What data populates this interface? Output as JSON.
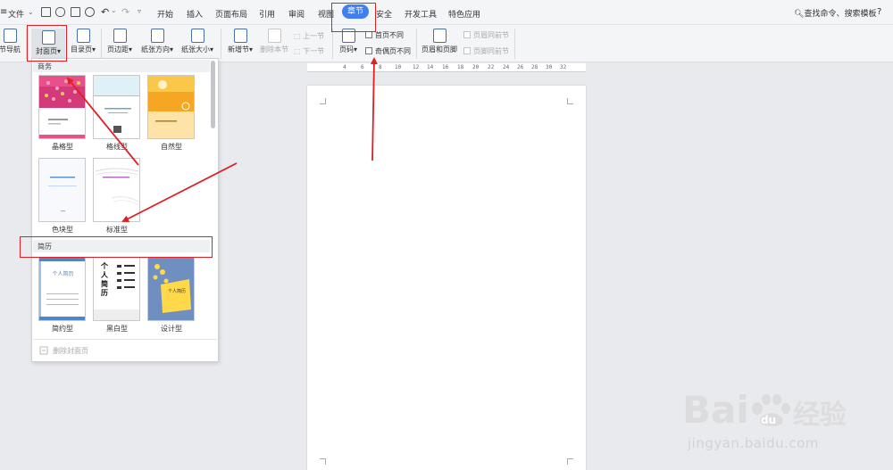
{
  "menubar": {
    "file": "文件",
    "tabs": [
      "开始",
      "插入",
      "页面布局",
      "引用",
      "审阅",
      "视图",
      "章节",
      "安全",
      "开发工具",
      "特色应用"
    ],
    "active_tab": "章节",
    "search": "查找命令、搜索模板",
    "help": "?"
  },
  "ribbon": {
    "section_nav": "节导航",
    "cover_page": "封面页",
    "toc_page": "目录页",
    "margins": "页边距",
    "orientation": "纸张方向",
    "paper_size": "纸张大小",
    "new_section": "新增节",
    "delete_section": "删除本节",
    "prev_section": "上一节",
    "next_section": "下一节",
    "page_number": "页码",
    "first_page_diff": "首页不同",
    "odd_even_diff": "奇偶页不同",
    "header_footer": "页眉和页脚",
    "header_same_prev": "页眉同前节",
    "footer_same_prev": "页脚同前节"
  },
  "ruler": {
    "ticks": [
      "4",
      "6",
      "8",
      "10",
      "12",
      "14",
      "16",
      "18",
      "20",
      "22",
      "24",
      "26",
      "28",
      "30",
      "32",
      "34",
      "36",
      "38"
    ]
  },
  "gallery": {
    "section_business": "商务",
    "section_resume": "简历",
    "business_items": [
      "晶格型",
      "格线型",
      "自然型",
      "色块型",
      "标准型"
    ],
    "resume_items": [
      "简约型",
      "黑白型",
      "设计型"
    ],
    "resume_thumb_title": "个人简历",
    "resume_vertical": [
      "个",
      "人",
      "简",
      "历"
    ],
    "footer": "删除封面页"
  },
  "watermark": {
    "brand_cn": "经验",
    "url": "jingyan.baidu.com"
  },
  "colors": {
    "accent": "#3f7ff0",
    "annotation": "#e01f26",
    "page_bg": "#e9eaed"
  }
}
